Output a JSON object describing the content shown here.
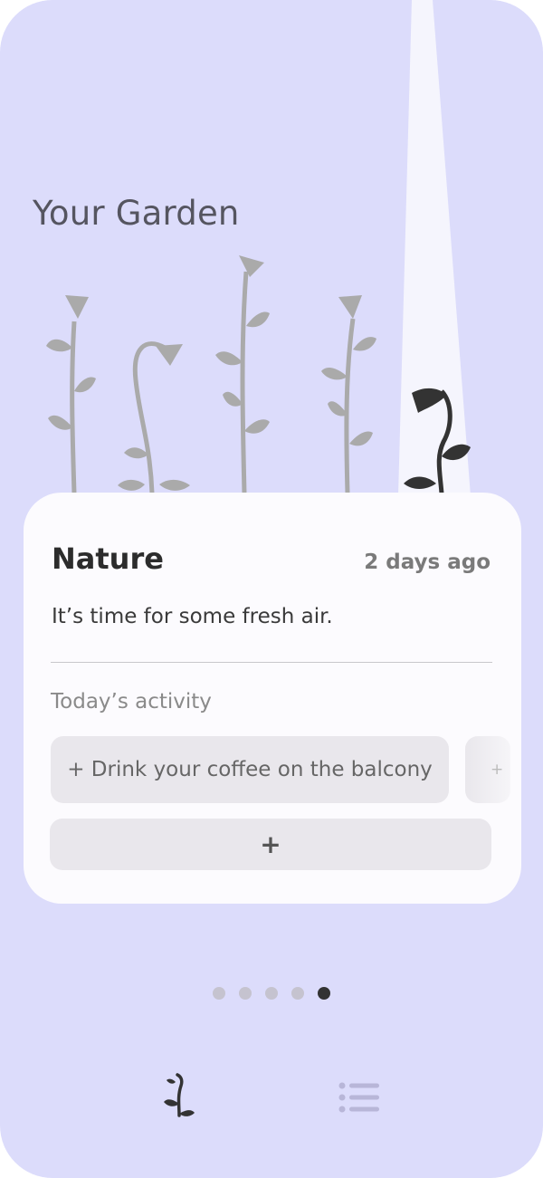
{
  "header": {
    "title": "Your Garden"
  },
  "card": {
    "title": "Nature",
    "time": "2 days ago",
    "description": "It’s time for some fresh air.",
    "section_label": "Today’s activity",
    "activities": [
      {
        "label": "+ Drink your coffee on the balcony"
      },
      {
        "label": "+"
      }
    ],
    "add_label": "+"
  },
  "pagination": {
    "total": 5,
    "active_index": 4
  },
  "bottom_nav": {
    "items": [
      "garden-icon",
      "list-icon"
    ],
    "active": "garden-icon"
  },
  "colors": {
    "background": "#dcdcfb",
    "card": "#fcfbfe",
    "plant_inactive": "#aaaaaa",
    "plant_active": "#333333"
  }
}
